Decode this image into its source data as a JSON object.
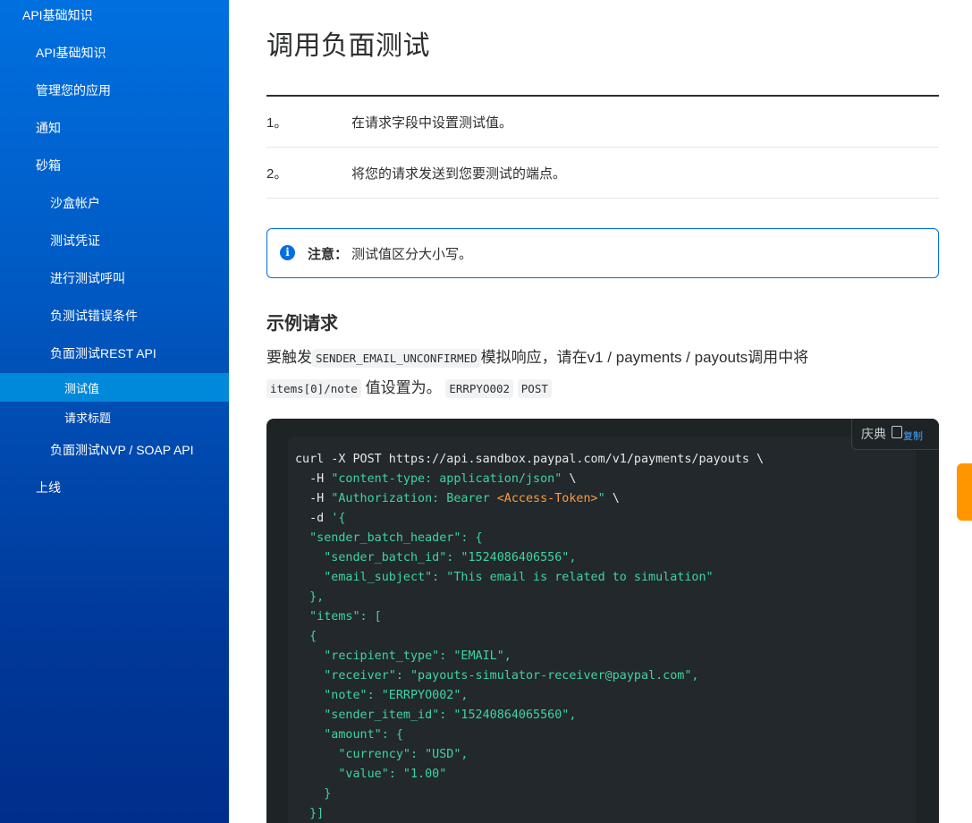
{
  "sidebar": {
    "items": [
      {
        "label": "API基础知识",
        "level": 0,
        "active": false
      },
      {
        "label": "API基础知识",
        "level": 1,
        "active": false
      },
      {
        "label": "管理您的应用",
        "level": 1,
        "active": false
      },
      {
        "label": "通知",
        "level": 1,
        "active": false
      },
      {
        "label": "砂箱",
        "level": 1,
        "active": false
      },
      {
        "label": "沙盒帐户",
        "level": 2,
        "active": false
      },
      {
        "label": "测试凭证",
        "level": 2,
        "active": false
      },
      {
        "label": "进行测试呼叫",
        "level": 2,
        "active": false
      },
      {
        "label": "负测试错误条件",
        "level": 2,
        "active": false
      },
      {
        "label": "负面测试REST API",
        "level": 2,
        "active": false
      },
      {
        "label": "测试值",
        "level": 3,
        "active": true
      },
      {
        "label": "请求标题",
        "level": 3,
        "active": false
      },
      {
        "label": "负面测试NVP / SOAP API",
        "level": 2,
        "active": false
      },
      {
        "label": "上线",
        "level": 1,
        "active": false
      }
    ]
  },
  "main": {
    "title": "调用负面测试",
    "steps": [
      {
        "num": "1。",
        "text": "在请求字段中设置测试值。"
      },
      {
        "num": "2。",
        "text": "将您的请求发送到您要测试的端点。"
      }
    ],
    "note": {
      "icon": "info-icon",
      "icon_glyph": "i",
      "label": "注意：",
      "text": "测试值区分大小写。"
    },
    "example_heading": "示例请求",
    "para": {
      "t1": "要触发",
      "c1": "SENDER_EMAIL_UNCONFIRMED",
      "t2": "模拟响应，请在v1 / payments / payouts调用中将",
      "c2": "items[0]/note",
      "t3": "值设置为。",
      "c3": "ERRPYO002",
      "c4": "POST"
    },
    "code_block": {
      "copy_text": "庆典",
      "copy_label": "复制",
      "lines": [
        "curl -X POST https://api.sandbox.paypal.com/v1/payments/payouts \\",
        "  -H ",
        "\"content-type: application/json\"",
        " \\",
        "  -H ",
        "\"Authorization: Bearer ",
        "<Access-Token>",
        "\"",
        " \\",
        "  -d ",
        "'{",
        "  \"sender_batch_header\": {",
        "    \"sender_batch_id\": \"1524086406556\",",
        "    \"email_subject\": \"This email is related to simulation\"",
        "  },",
        "  \"items\": [",
        "  {",
        "    \"recipient_type\": \"EMAIL\",",
        "    \"receiver\": \"payouts-simulator-receiver@paypal.com\",",
        "    \"note\": \"ERRPYO002\",",
        "    \"sender_item_id\": \"15240864065560\",",
        "    \"amount\": {",
        "      \"currency\": \"USD\",",
        "      \"value\": \"1.00\"",
        "    }",
        "  }]"
      ]
    }
  }
}
